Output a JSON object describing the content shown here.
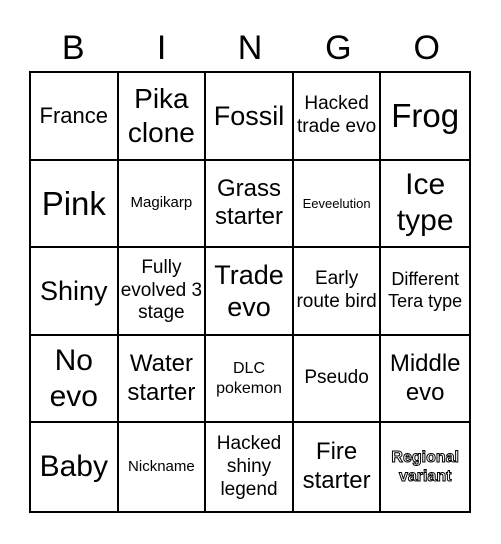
{
  "header": {
    "letters": [
      "B",
      "I",
      "N",
      "G",
      "O"
    ]
  },
  "cells": [
    {
      "text": "France",
      "size": 22
    },
    {
      "text": "Pika clone",
      "size": 28
    },
    {
      "text": "Fossil",
      "size": 27
    },
    {
      "text": "Hacked trade evo",
      "size": 19
    },
    {
      "text": "Frog",
      "size": 33
    },
    {
      "text": "Pink",
      "size": 33
    },
    {
      "text": "Magikarp",
      "size": 15
    },
    {
      "text": "Grass starter",
      "size": 24
    },
    {
      "text": "Eeveelution",
      "size": 13
    },
    {
      "text": "Ice type",
      "size": 30
    },
    {
      "text": "Shiny",
      "size": 27
    },
    {
      "text": "Fully evolved 3 stage",
      "size": 19
    },
    {
      "text": "Trade evo",
      "size": 27
    },
    {
      "text": "Early route bird",
      "size": 19
    },
    {
      "text": "Different Tera type",
      "size": 18
    },
    {
      "text": "No evo",
      "size": 30
    },
    {
      "text": "Water starter",
      "size": 24
    },
    {
      "text": "DLC pokemon",
      "size": 16
    },
    {
      "text": "Pseudo",
      "size": 19
    },
    {
      "text": "Middle evo",
      "size": 24
    },
    {
      "text": "Baby",
      "size": 30
    },
    {
      "text": "Nickname",
      "size": 15
    },
    {
      "text": "Hacked shiny legend",
      "size": 19
    },
    {
      "text": "Fire starter",
      "size": 24
    },
    {
      "text": "Regional variant",
      "size": 16,
      "style": "outlined"
    }
  ]
}
